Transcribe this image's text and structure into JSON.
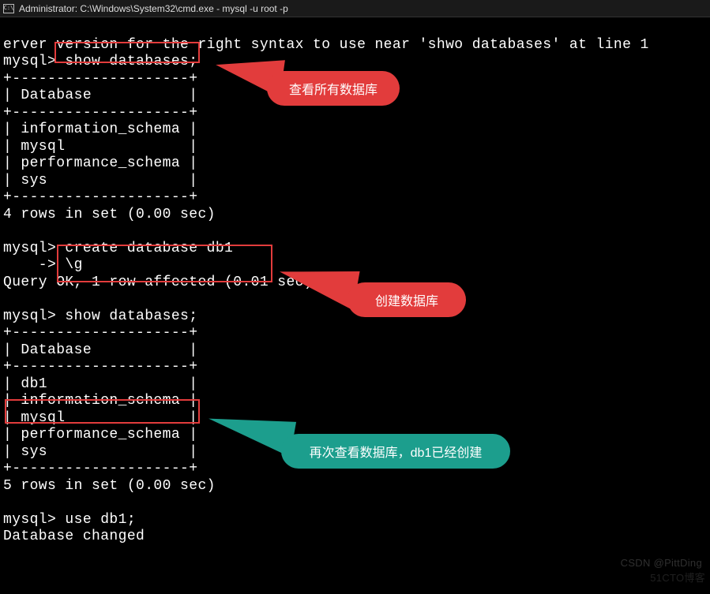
{
  "titlebar": {
    "icon_label": "C:\\",
    "text": "Administrator: C:\\Windows\\System32\\cmd.exe - mysql  -u root -p"
  },
  "terminal": {
    "error_line": "erver version for the right syntax to use near 'shwo databases' at line 1",
    "prompt": "mysql>",
    "cont_prompt": "    ->",
    "cmd_show": " show databases;",
    "table_border": "+--------------------+",
    "table_header": "| Database           |",
    "row_info": "| information_schema |",
    "row_mysql": "| mysql              |",
    "row_perf": "| performance_schema |",
    "row_sys": "| sys                |",
    "rows4": "4 rows in set (0.00 sec)",
    "cmd_create": " create database db1",
    "cmd_g": " \\g",
    "query_ok": "Query OK, 1 row affected (0.01 sec)",
    "row_db1": "| db1                |",
    "rows5": "5 rows in set (0.00 sec)",
    "cmd_use": " use db1;",
    "db_changed": "Database changed"
  },
  "callouts": {
    "show_all": "查看所有数据库",
    "create_db": "创建数据库",
    "recheck": "再次查看数据库，db1已经创建"
  },
  "watermark1": "CSDN @PittDing",
  "watermark2": "51CTO博客"
}
